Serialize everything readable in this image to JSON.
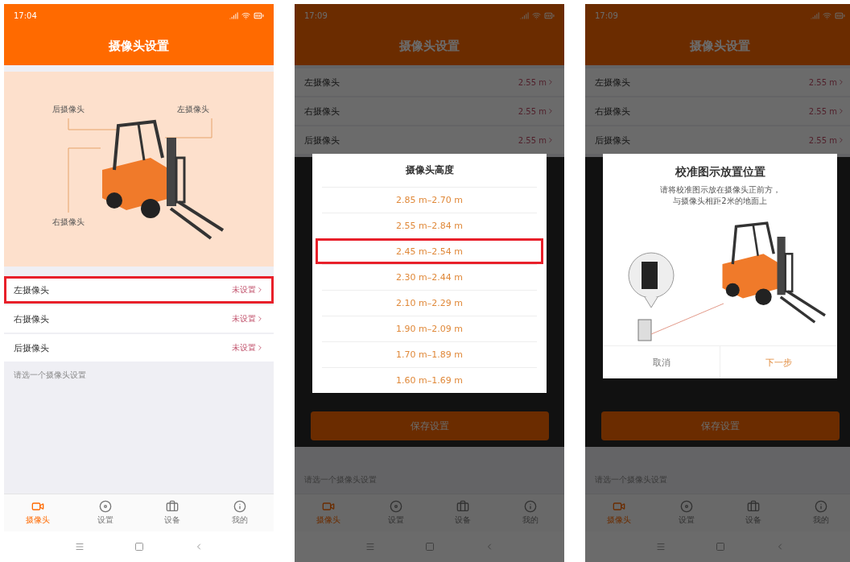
{
  "screens": [
    {
      "kind": "main",
      "status_time": "17:04",
      "title": "摄像头设置",
      "illustration_labels": [
        "后摄像头",
        "左摄像头",
        "右摄像头"
      ],
      "cameras": [
        {
          "name": "左摄像头",
          "status": "未设置",
          "highlighted": true
        },
        {
          "name": "右摄像头",
          "status": "未设置",
          "highlighted": false
        },
        {
          "name": "后摄像头",
          "status": "未设置",
          "highlighted": false
        }
      ],
      "hint": "请选一个摄像头设置",
      "tabs": [
        {
          "label": "摄像头",
          "selected": true
        },
        {
          "label": "设置",
          "selected": false
        },
        {
          "label": "设备",
          "selected": false
        },
        {
          "label": "我的",
          "selected": false
        }
      ]
    },
    {
      "kind": "picker",
      "status_time": "17:09",
      "title": "摄像头设置",
      "cameras": [
        {
          "name": "左摄像头",
          "status": "2.55 m",
          "highlighted": false
        },
        {
          "name": "右摄像头",
          "status": "2.55 m",
          "highlighted": false
        },
        {
          "name": "后摄像头",
          "status": "2.55 m",
          "highlighted": false
        }
      ],
      "save_button": "保存设置",
      "hint": "请选一个摄像头设置",
      "tabs": [
        {
          "label": "摄像头",
          "selected": true
        },
        {
          "label": "设置",
          "selected": false
        },
        {
          "label": "设备",
          "selected": false
        },
        {
          "label": "我的",
          "selected": false
        }
      ],
      "dialog": {
        "title": "摄像头高度",
        "options": [
          {
            "label": "2.85 m–2.70 m",
            "highlighted": false
          },
          {
            "label": "2.55 m–2.84 m",
            "highlighted": false
          },
          {
            "label": "2.45 m–2.54 m",
            "highlighted": true
          },
          {
            "label": "2.30 m–2.44 m",
            "highlighted": false
          },
          {
            "label": "2.10 m–2.29 m",
            "highlighted": false
          },
          {
            "label": "1.90 m–2.09 m",
            "highlighted": false
          },
          {
            "label": "1.70 m–1.89 m",
            "highlighted": false
          },
          {
            "label": "1.60 m–1.69 m",
            "highlighted": false
          }
        ]
      }
    },
    {
      "kind": "calibration",
      "status_time": "17:09",
      "title": "摄像头设置",
      "cameras": [
        {
          "name": "左摄像头",
          "status": "2.55 m",
          "highlighted": false
        },
        {
          "name": "右摄像头",
          "status": "2.55 m",
          "highlighted": false
        },
        {
          "name": "后摄像头",
          "status": "2.55 m",
          "highlighted": false
        }
      ],
      "save_button": "保存设置",
      "hint": "请选一个摄像头设置",
      "tabs": [
        {
          "label": "摄像头",
          "selected": true
        },
        {
          "label": "设置",
          "selected": false
        },
        {
          "label": "设备",
          "selected": false
        },
        {
          "label": "我的",
          "selected": false
        }
      ],
      "dialog": {
        "title": "校准图示放置位置",
        "lines": [
          "请将校准图示放在摄像头正前方，",
          "与摄像头相距2米的地面上"
        ],
        "buttons": [
          {
            "label": "取消",
            "kind": "cancel"
          },
          {
            "label": "下一步",
            "kind": "primary"
          }
        ]
      }
    }
  ]
}
